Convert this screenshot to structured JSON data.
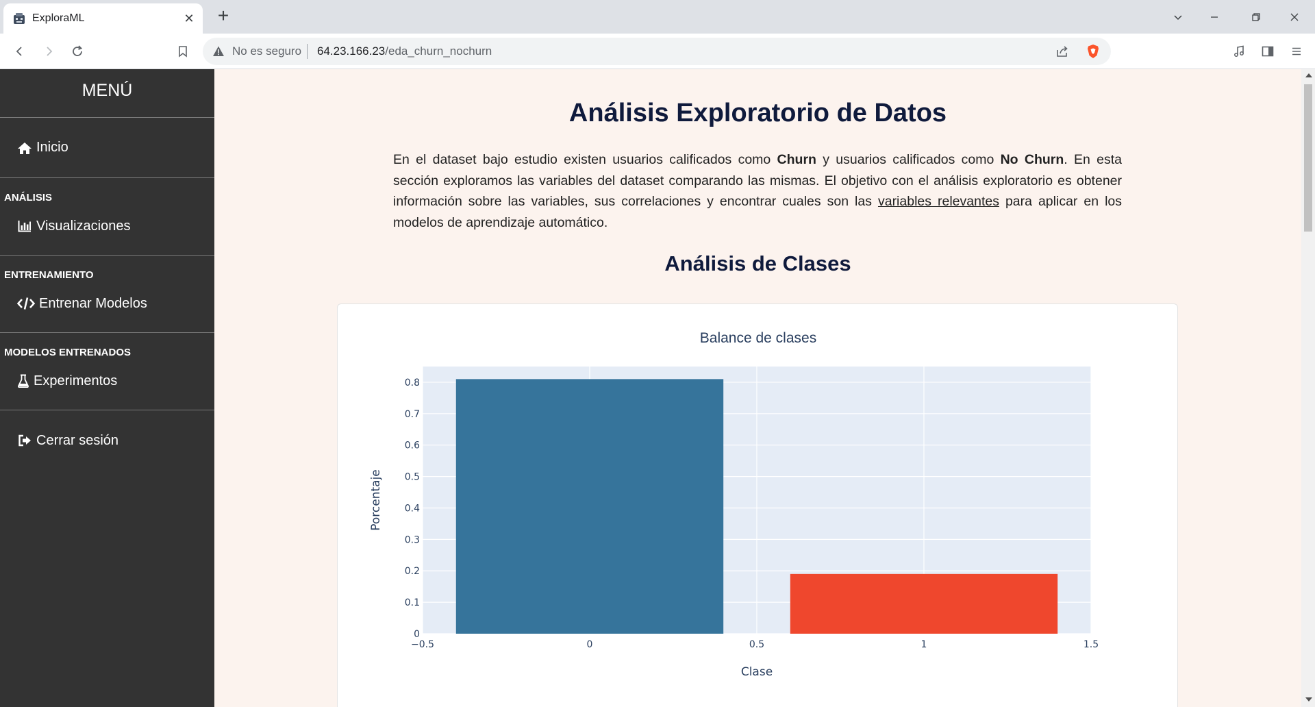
{
  "browser": {
    "tab_title": "ExploraML",
    "tab_close": "✕",
    "new_tab": "+",
    "security_label": "No es seguro",
    "url_host": "64.23.166.23",
    "url_path": "/eda_churn_nochurn"
  },
  "sidebar": {
    "menu_title": "MENÚ",
    "home": "Inicio",
    "sections": [
      {
        "label": "ANÁLISIS",
        "item": "Visualizaciones",
        "icon": "bar-chart-icon"
      },
      {
        "label": "ENTRENAMIENTO",
        "item": "Entrenar Modelos",
        "icon": "code-icon"
      },
      {
        "label": "MODELOS ENTRENADOS",
        "item": "Experimentos",
        "icon": "flask-icon"
      }
    ],
    "logout": "Cerrar sesión"
  },
  "main": {
    "title": "Análisis Exploratorio de Datos",
    "intro": {
      "p1": "En el dataset bajo estudio existen usuarios calificados como ",
      "churn": "Churn",
      "p2": " y usuarios calificados como ",
      "nochurn": "No Churn",
      "p3": ". En esta sección exploramos las variables del dataset comparando las mismas. El objetivo con el análisis exploratorio es obtener información sobre las variables, sus correlaciones y encontrar cuales son las ",
      "link": "variables relevantes",
      "p4": " para aplicar en los modelos de aprendizaje automático."
    },
    "section_title": "Análisis de Clases"
  },
  "chart_data": {
    "type": "bar",
    "title": "Balance de clases",
    "xlabel": "Clase",
    "ylabel": "Porcentaje",
    "x": [
      0,
      1
    ],
    "values": [
      0.81,
      0.19
    ],
    "colors": [
      "#36749b",
      "#ef472d"
    ],
    "bar_width": 0.8,
    "xlim": [
      -0.5,
      1.5
    ],
    "ylim": [
      0,
      0.85
    ],
    "xticks": [
      -0.5,
      0,
      0.5,
      1,
      1.5
    ],
    "xtick_labels": [
      "−0.5",
      "0",
      "0.5",
      "1",
      "1.5"
    ],
    "yticks": [
      0,
      0.1,
      0.2,
      0.3,
      0.4,
      0.5,
      0.6,
      0.7,
      0.8
    ],
    "ytick_labels": [
      "0",
      "0.1",
      "0.2",
      "0.3",
      "0.4",
      "0.5",
      "0.6",
      "0.7",
      "0.8"
    ],
    "plot_bg": "#e5ecf6",
    "grid": true
  }
}
